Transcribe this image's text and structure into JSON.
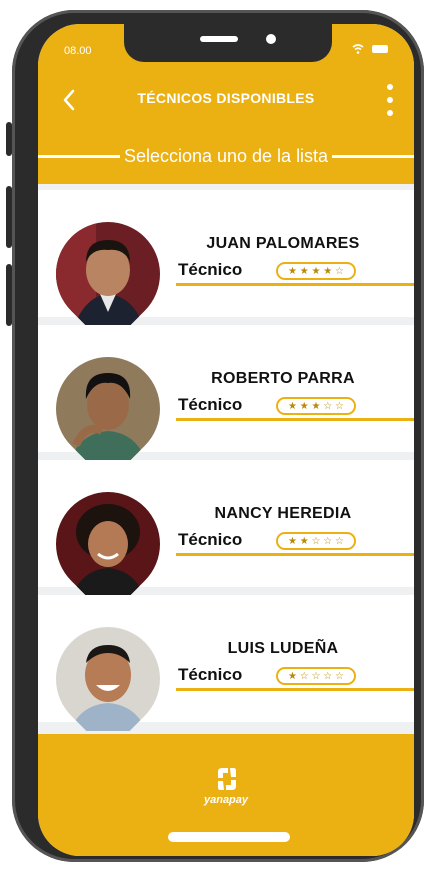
{
  "status": {
    "time": "08.00"
  },
  "header": {
    "title": "TÉCNICOS DISPONIBLES",
    "subtitle": "Selecciona uno de la lista"
  },
  "technicians": [
    {
      "name": "JUAN PALOMARES",
      "role": "Técnico",
      "rating": 4,
      "stars": "★ ★ ★ ★ ☆",
      "avatar": "person-photo-1"
    },
    {
      "name": "ROBERTO PARRA",
      "role": "Técnico",
      "rating": 3,
      "stars": "★ ★ ★ ☆ ☆",
      "avatar": "person-photo-2"
    },
    {
      "name": "NANCY HEREDIA",
      "role": "Técnico",
      "rating": 2,
      "stars": "★ ★ ☆ ☆ ☆",
      "avatar": "person-photo-3"
    },
    {
      "name": "LUIS LUDEÑA",
      "role": "Técnico",
      "rating": 1,
      "stars": "★ ☆ ☆ ☆ ☆",
      "avatar": "person-photo-4"
    }
  ],
  "footer": {
    "brand": "yanapay"
  },
  "colors": {
    "accent": "#ebb012",
    "background": "#eef0f2",
    "card": "#ffffff"
  }
}
